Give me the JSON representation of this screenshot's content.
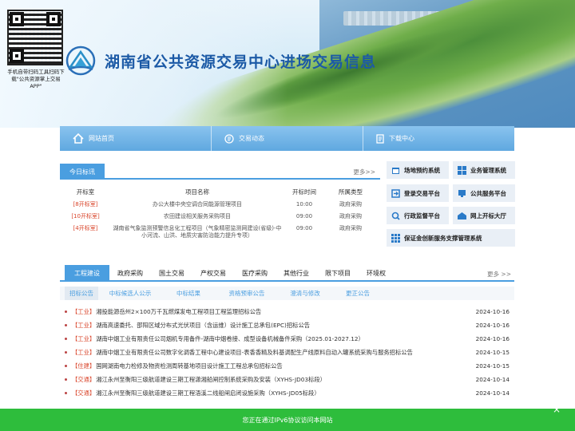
{
  "qr": {
    "caption": "手机自带扫码工具扫码下载\"公共资源掌上交易APP\""
  },
  "site": {
    "title": "湖南省公共资源交易中心进场交易信息"
  },
  "nav": [
    {
      "label": "网站首页",
      "icon": "home-icon"
    },
    {
      "label": "交易动态",
      "icon": "document-icon"
    },
    {
      "label": "下载中心",
      "icon": "download-icon"
    }
  ],
  "today": {
    "tab": "今日标讯",
    "more": "更多>>",
    "headers": [
      "开标室",
      "项目名称",
      "开标时间",
      "所属类型"
    ],
    "rows": [
      {
        "room": "[8开标室]",
        "name": "办公大楼中央空调合同能源管理项目",
        "time": "10:00",
        "type": "政府采购"
      },
      {
        "room": "[10开标室]",
        "name": "农田建设相关服务采购项目",
        "time": "09:00",
        "type": "政府采购"
      },
      {
        "room": "[4开标室]",
        "name": "湖南省气象监测预警信息化工程项目（气象精密监测网建设(省级)-中小河流、山洪、地质灾害防治能力提升专项）",
        "time": "09:00",
        "type": "政府采购"
      }
    ]
  },
  "quick": [
    {
      "label": "场地预约系统",
      "icon": "calendar-icon"
    },
    {
      "label": "业务管理系统",
      "icon": "windows-icon"
    },
    {
      "label": "登录交易平台",
      "icon": "login-icon"
    },
    {
      "label": "公共服务平台",
      "icon": "service-icon"
    },
    {
      "label": "行政监督平台",
      "icon": "supervision-icon"
    },
    {
      "label": "网上开标大厅",
      "icon": "hall-icon"
    },
    {
      "label": "保证金创新服务支撑管理系统",
      "icon": "grid-icon"
    }
  ],
  "categories": {
    "tabs": [
      "工程建设",
      "政府采购",
      "国土交易",
      "产权交易",
      "医疗采购",
      "其他行业",
      "限下项目",
      "环境权"
    ],
    "active": 0,
    "more": "更多 >>",
    "sub_tabs": [
      "招标公告",
      "中标候选人公示",
      "中标结果",
      "资格预审公告",
      "澄清与修改",
      "更正公告"
    ],
    "items": [
      {
        "tag": "【工业】",
        "text": "湘投能源岳州2×100万千瓦燃煤发电工程项目工程监理招标公告",
        "date": "2024-10-16"
      },
      {
        "tag": "【工业】",
        "text": "湖南高速委托、邵阳区域分布式光伏项目（含运维）设计施工总承包(EPC)招标公告",
        "date": "2024-10-16"
      },
      {
        "tag": "【工业】",
        "text": "湖南中烟工业有限责任公司烟机专用备件-湖南中烟卷接、成型设备机械备件采购（2025.01-2027.12）",
        "date": "2024-10-16"
      },
      {
        "tag": "【工业】",
        "text": "湖南中烟工业有限责任公司数字化调香工程中心建设项目-表香香精及料基调配生产线原料自动入罐系统采购与服务招标公告",
        "date": "2024-10-15"
      },
      {
        "tag": "【住建】",
        "text": "国网湖南电力检修及物资检测周转基地项目设计施工工程总承包招标公告",
        "date": "2024-10-15"
      },
      {
        "tag": "【交通】",
        "text": "湘江永州至衡阳三级航道建设三期工程潇湘船闸控制系统采购及安装（XYHS-JD03标段）",
        "date": "2024-10-14"
      },
      {
        "tag": "【交通】",
        "text": "湘江永州至衡阳三级航道建设三期工程浯溪二线船闸启闭设施采购（XYHS-JD05标段）",
        "date": "2024-10-14"
      }
    ]
  },
  "footer": {
    "notice": "您正在通过IPv6协议访问本网站",
    "close": "×"
  },
  "colors": {
    "accent": "#4a9ee0",
    "title": "#1c5aa6",
    "tag": "#d9442a",
    "footer": "#2ebd3c"
  }
}
